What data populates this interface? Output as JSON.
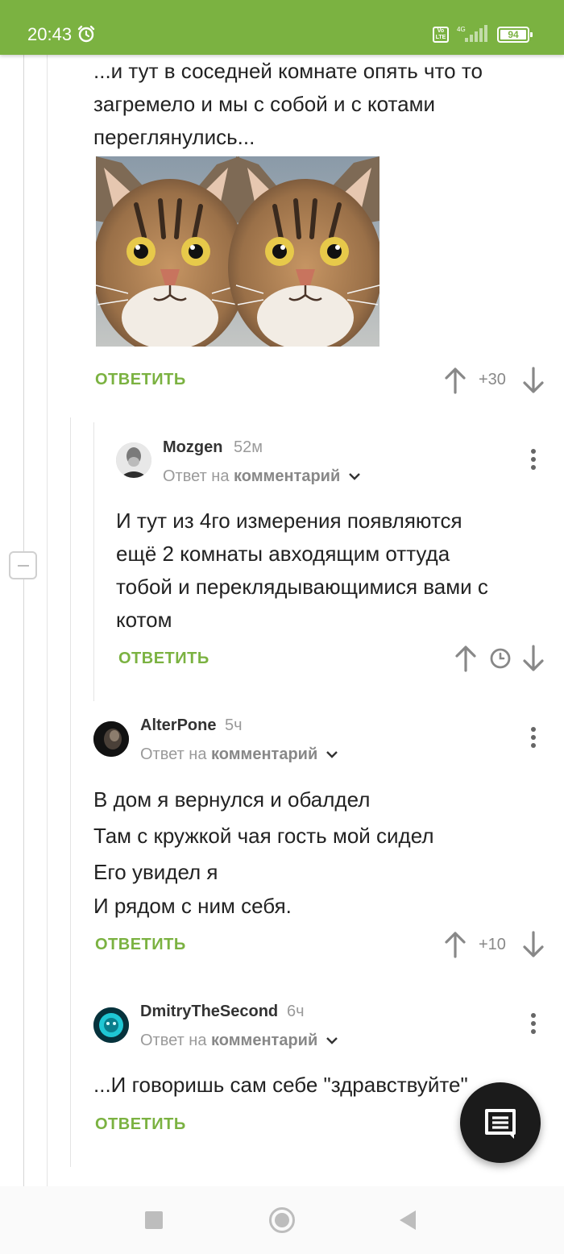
{
  "status_bar": {
    "time": "20:43",
    "network": "4G",
    "volte": "Vo LTE",
    "battery": "94"
  },
  "thread": {
    "top_comment": {
      "text": "...и тут в соседней комнате опять что то загремело и мы с собой и с котами переглянулись...",
      "image_icon": "mirrored-cat-photo",
      "reply_label": "ОТВЕТИТЬ",
      "score": "+30"
    },
    "comments": [
      {
        "username": "Mozgen",
        "time": "52м",
        "reply_to_prefix": "Ответ на",
        "reply_to_target": "комментарий",
        "lines": [
          "И тут из 4го измерения появляются",
          "ещё 2 комнаты авходящим оттуда",
          "тобой и переклядывающимися вами с",
          "котом"
        ],
        "reply_label": "ОТВЕТИТЬ",
        "score_icon": "clock-icon"
      },
      {
        "username": "AlterPone",
        "time": "5ч",
        "reply_to_prefix": "Ответ на",
        "reply_to_target": "комментарий",
        "lines": [
          "В дом я вернулся и обалдел",
          "Там с кружкой чая гость мой сидел",
          "Его увидел я",
          "И рядом с ним себя."
        ],
        "reply_label": "ОТВЕТИТЬ",
        "score": "+10"
      },
      {
        "username": "DmitryTheSecond",
        "time": "6ч",
        "reply_to_prefix": "Ответ на",
        "reply_to_target": "комментарий",
        "lines": [
          "...И говоришь сам себе \"здравствуйте\""
        ],
        "reply_label": "ОТВЕТИТЬ"
      }
    ]
  },
  "fab": {
    "icon": "comment-icon"
  },
  "nav_bar": {
    "recent": "recent-apps-icon",
    "home": "home-icon",
    "back": "back-icon"
  },
  "colors": {
    "accent": "#7bb241",
    "fab": "#1b1b1b"
  }
}
